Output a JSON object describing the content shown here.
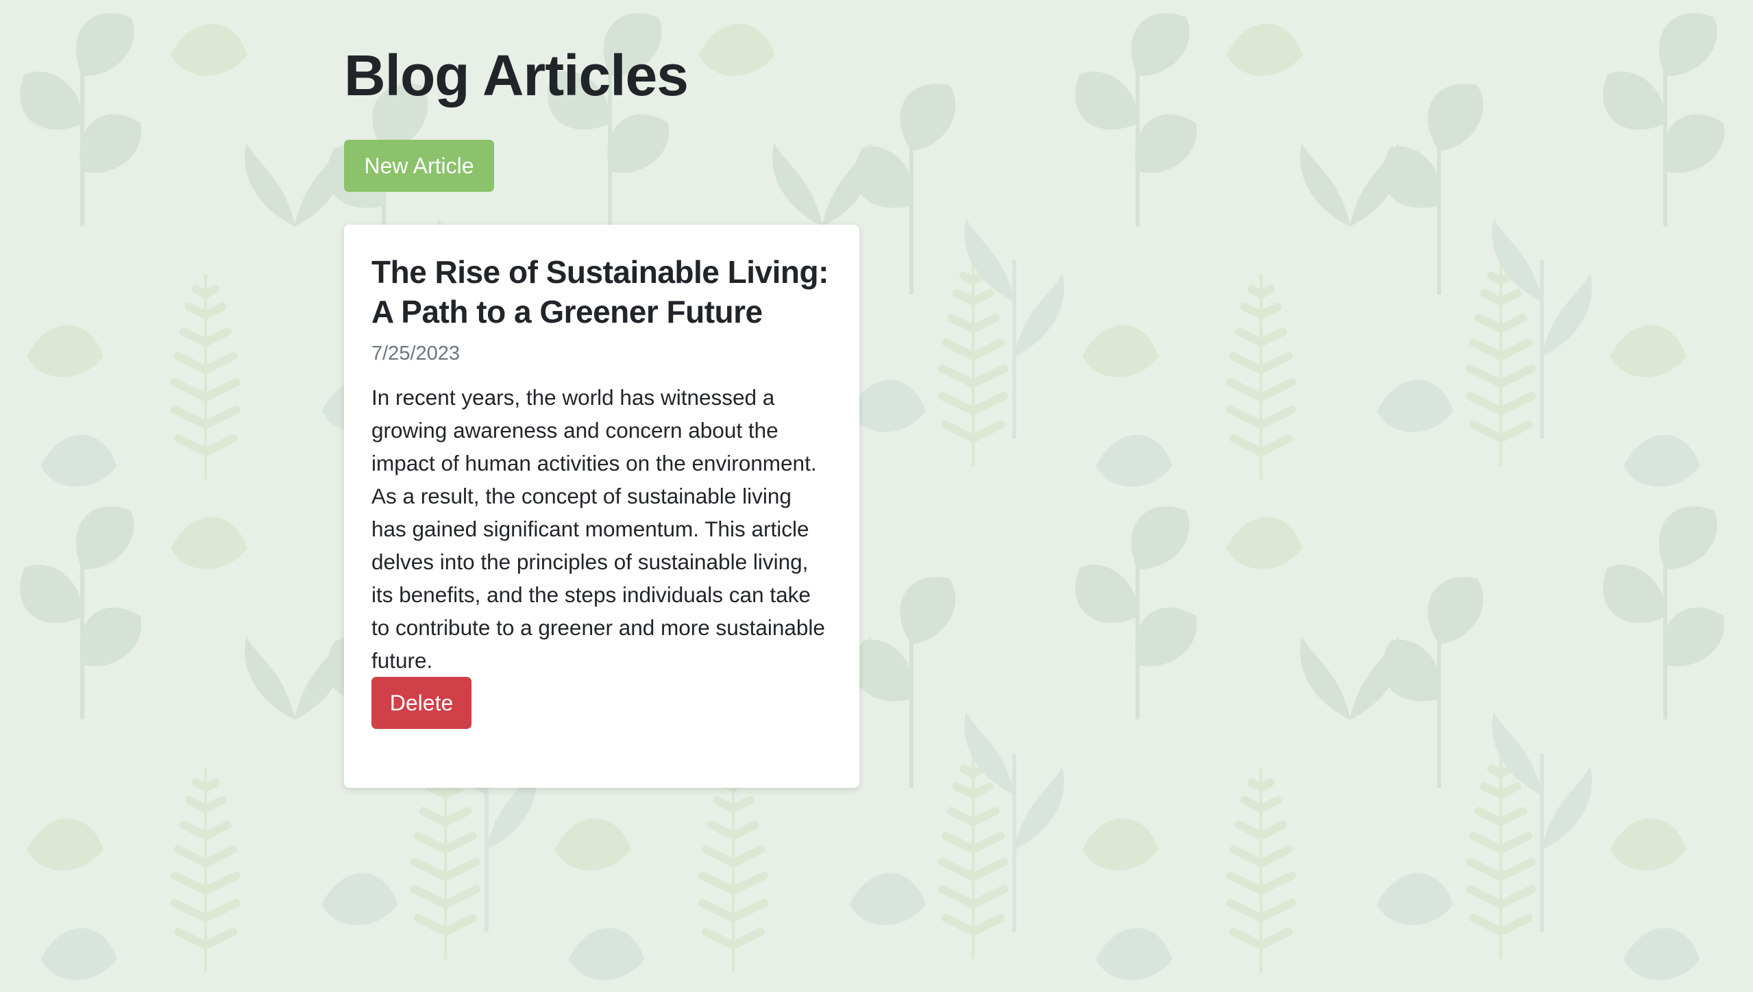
{
  "page": {
    "title": "Blog Articles",
    "new_article_label": "New Article"
  },
  "articles": [
    {
      "title": "The Rise of Sustainable Living: A Path to a Greener Future",
      "date": "7/25/2023",
      "body": "In recent years, the world has witnessed a growing awareness and concern about the impact of human activities on the environment. As a result, the concept of sustainable living has gained significant momentum. This article delves into the principles of sustainable living, its benefits, and the steps individuals can take to contribute to a greener and more sustainable future.",
      "delete_label": "Delete"
    }
  ],
  "colors": {
    "background": "#e8efe6",
    "new_button": "#8bc26b",
    "delete_button": "#d13f48",
    "card": "#ffffff",
    "title_text": "#212529",
    "date_text": "#6c757d"
  },
  "background_pattern": "botanical-leaves"
}
